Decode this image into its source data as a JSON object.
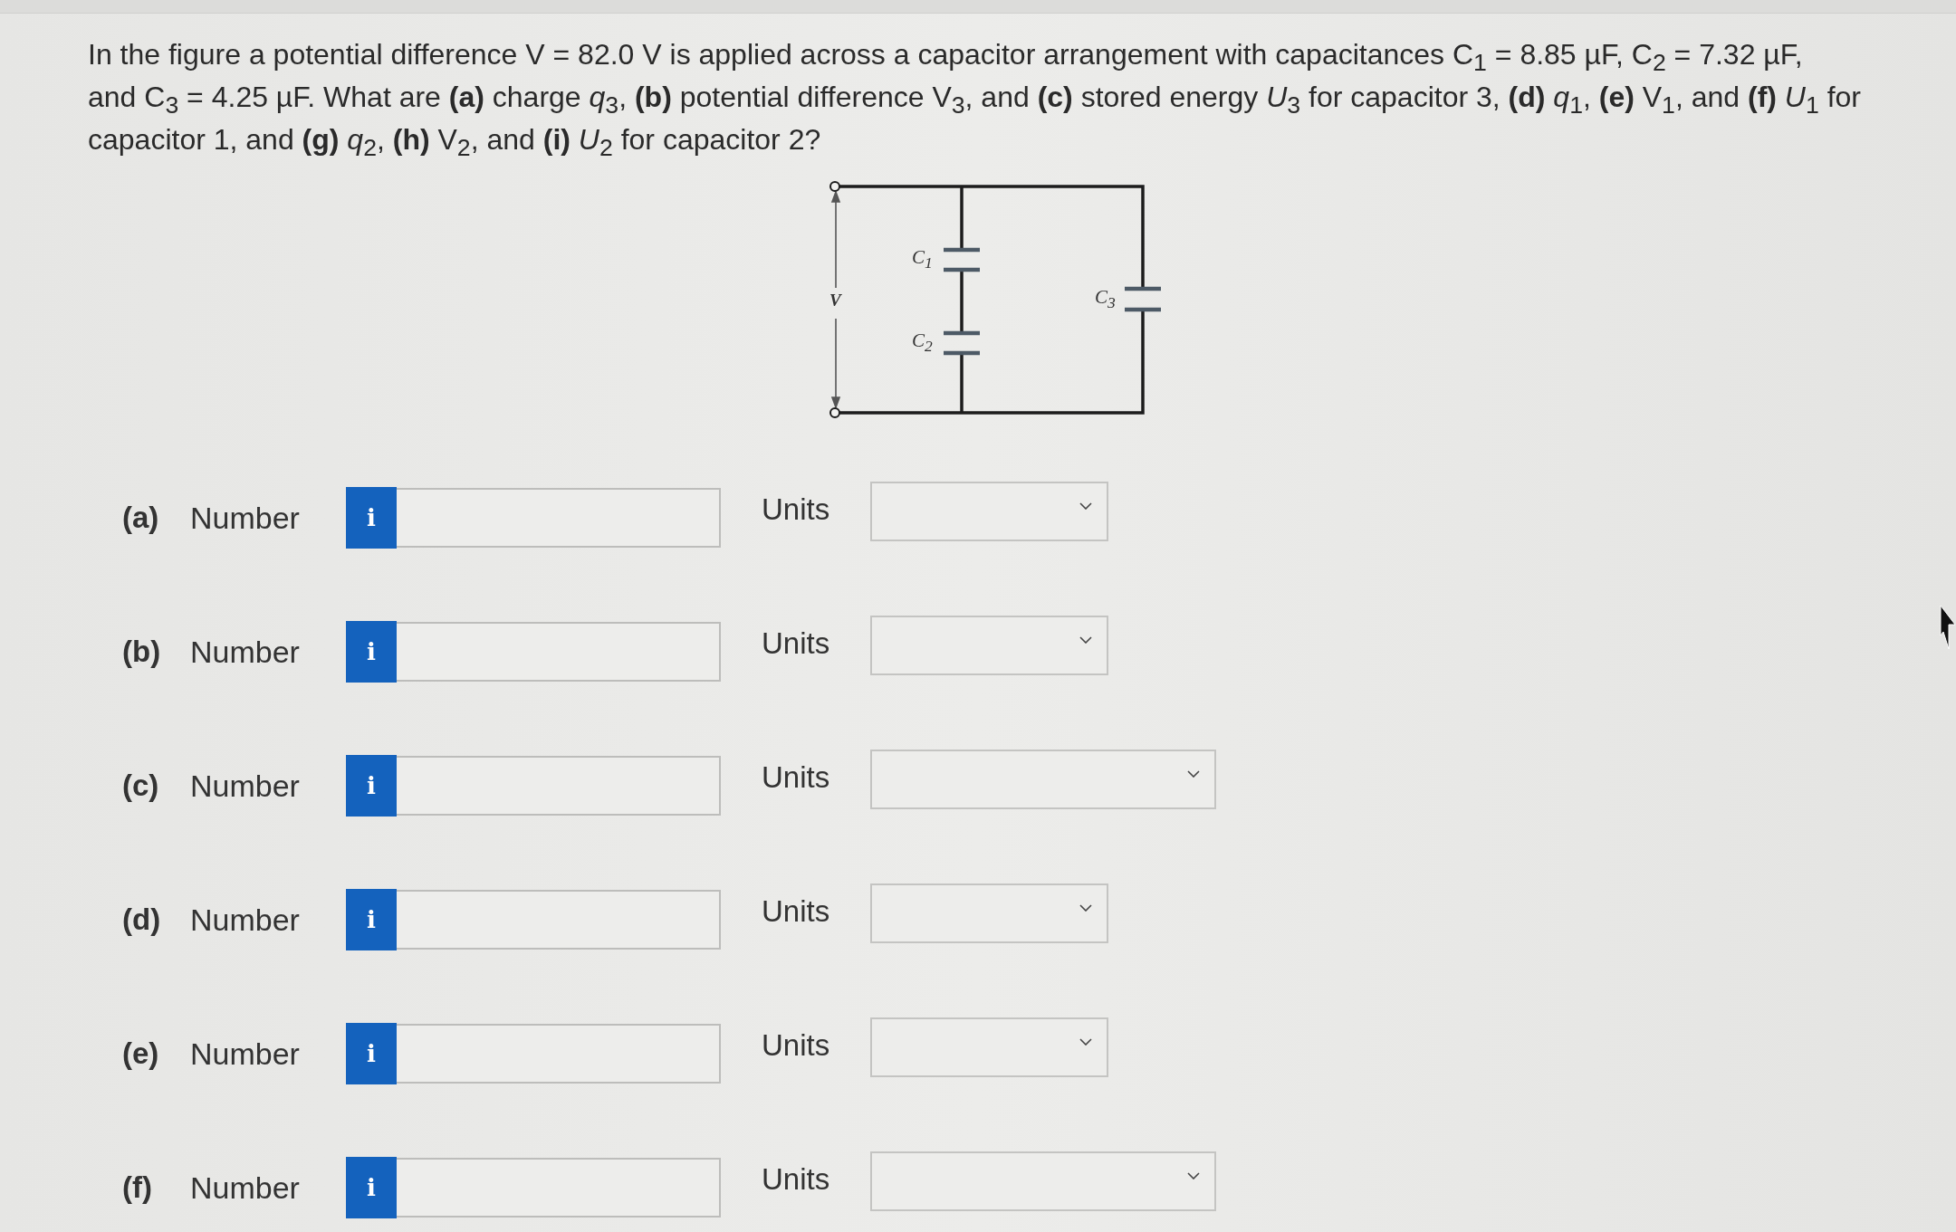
{
  "question": "In the figure a potential difference V = 82.0 V is applied across a capacitor arrangement with capacitances C$_{1}$ = 8.85 µF, C$_{2}$ = 7.32 µF,\nand C$_{3}$ = 4.25 µF. What are **(a)** charge *q*$_{3}$, **(b)** potential difference V$_{3}$, and **(c)** stored energy *U*$_{3}$ for capacitor 3, **(d)** *q*$_{1}$, **(e)** V$_{1}$, and **(f)** *U*$_{1}$ for\ncapacitor 1, and **(g)** *q*$_{2}$, **(h)** V$_{2}$, and **(i)** *U*$_{2}$ for capacitor 2?",
  "figure": {
    "voltage_label": "V",
    "capacitor_labels": [
      "C$_{1}$",
      "C$_{2}$",
      "C$_{3}$"
    ]
  },
  "answers": [
    {
      "part": "(a)",
      "field_label": "Number",
      "info_button": "i",
      "units_label": "Units"
    },
    {
      "part": "(b)",
      "field_label": "Number",
      "info_button": "i",
      "units_label": "Units"
    },
    {
      "part": "(c)",
      "field_label": "Number",
      "info_button": "i",
      "units_label": "Units"
    },
    {
      "part": "(d)",
      "field_label": "Number",
      "info_button": "i",
      "units_label": "Units"
    },
    {
      "part": "(e)",
      "field_label": "Number",
      "info_button": "i",
      "units_label": "Units"
    },
    {
      "part": "(f)",
      "field_label": "Number",
      "info_button": "i",
      "units_label": "Units"
    }
  ]
}
